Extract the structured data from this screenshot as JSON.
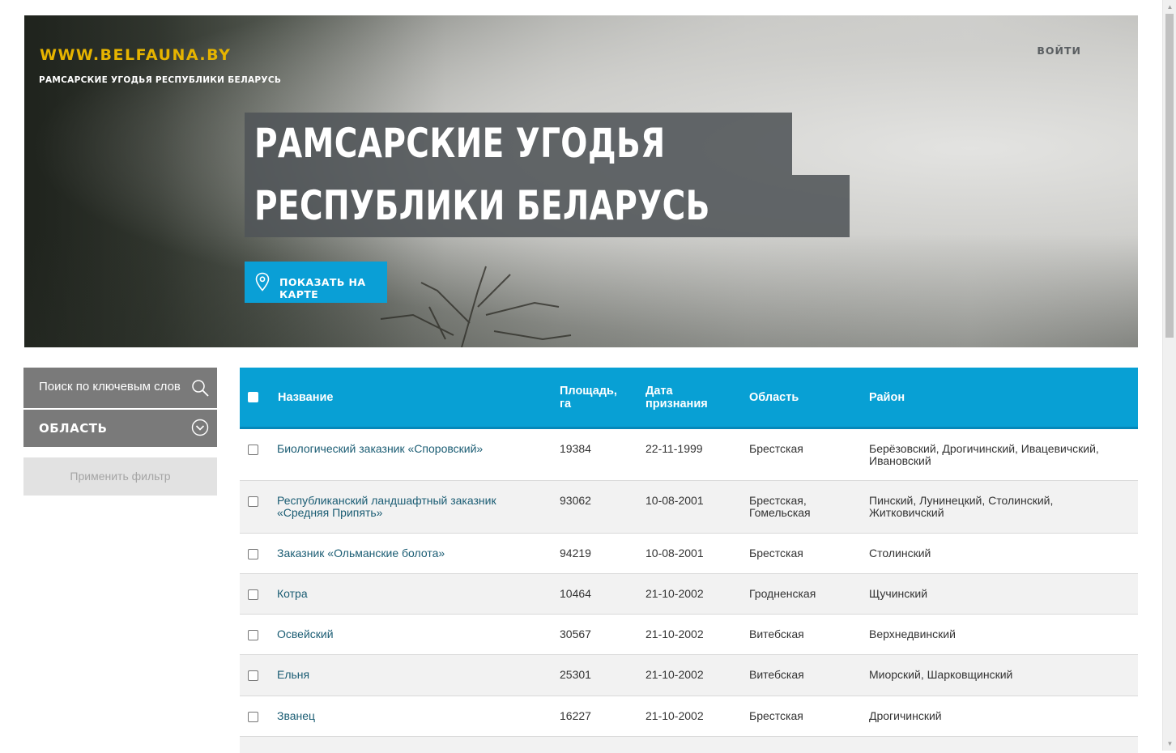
{
  "site": {
    "logo": "WWW.BELFAUNA.BY",
    "subtitle": "РАМСАРСКИЕ УГОДЬЯ РЕСПУБЛИКИ БЕЛАРУСЬ",
    "login": "ВОЙТИ"
  },
  "hero": {
    "headline_line1": "РАМСАРСКИЕ УГОДЬЯ",
    "headline_line2": "РЕСПУБЛИКИ БЕЛАРУСЬ",
    "map_button": "ПОКАЗАТЬ НА КАРТЕ",
    "map_icon": "map-pin-icon"
  },
  "filters": {
    "search_placeholder": "Поиск по ключевым слов",
    "search_icon": "search-icon",
    "region_label": "ОБЛАСТЬ",
    "region_icon": "chevron-down-circle-icon",
    "apply_label": "Применить фильтр"
  },
  "table": {
    "headers": {
      "name": "Название",
      "area": "Площадь, га",
      "date": "Дата признания",
      "oblast": "Область",
      "district": "Район"
    },
    "rows": [
      {
        "name": "Биологический заказник «Споровский»",
        "area": "19384",
        "date": "22-11-1999",
        "oblast": "Брестская",
        "district": "Берёзовский, Дрогичинский, Ивацевичский, Ивановский"
      },
      {
        "name": "Республиканский ландшафтный заказник «Средняя Припять»",
        "area": "93062",
        "date": "10-08-2001",
        "oblast": "Брестская, Гомельская",
        "district": "Пинский, Лунинецкий, Столинский, Житковичский"
      },
      {
        "name": "Заказник «Ольманские болота»",
        "area": "94219",
        "date": "10-08-2001",
        "oblast": "Брестская",
        "district": "Столинский"
      },
      {
        "name": "Котра",
        "area": "10464",
        "date": "21-10-2002",
        "oblast": "Гродненская",
        "district": "Щучинский"
      },
      {
        "name": "Освейский",
        "area": "30567",
        "date": "21-10-2002",
        "oblast": "Витебская",
        "district": "Верхнедвинский"
      },
      {
        "name": "Ельня",
        "area": "25301",
        "date": "21-10-2002",
        "oblast": "Витебская",
        "district": "Миорский, Шарковщинский"
      },
      {
        "name": "Званец",
        "area": "16227",
        "date": "21-10-2002",
        "oblast": "Брестская",
        "district": "Дрогичинский"
      }
    ]
  },
  "colors": {
    "accent": "#08a0d4",
    "logo": "#e6b400",
    "sidebar": "#7a7a7a",
    "link": "#1a5c73"
  }
}
